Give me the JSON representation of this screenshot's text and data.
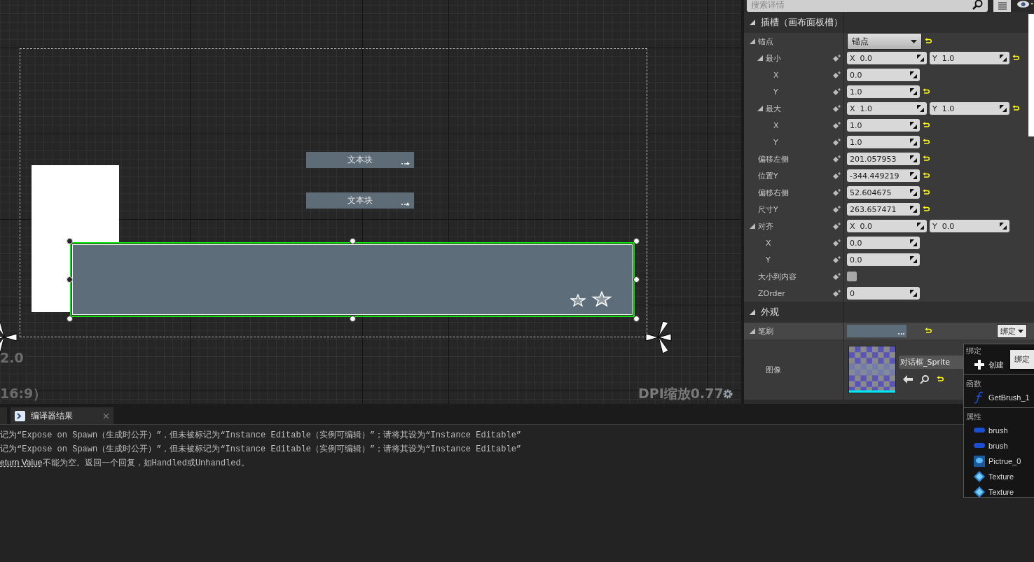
{
  "canvas": {
    "zoom_label": "2.0",
    "aspect_label": "16:9）",
    "dpi_label": "DPI缩放0.77",
    "text_blocks": [
      {
        "text": "文本块"
      },
      {
        "text": "文本块"
      }
    ],
    "image_widget": {
      "selected": true
    }
  },
  "details": {
    "search": {
      "placeholder": "搜索详情"
    },
    "sections": [
      {
        "title": "插槽（画布面板槽）",
        "expanded": true,
        "rows": [
          {
            "label": "锚点",
            "kind": "dropdown",
            "value": "锚点",
            "expanded": true,
            "bindable": false,
            "reset": true,
            "children": [
              {
                "label": "最小",
                "kind": "vector",
                "values": [
                  {
                    "axis": "X",
                    "value": "0.0"
                  },
                  {
                    "axis": "Y",
                    "value": "1.0"
                  }
                ],
                "expanded": true,
                "bindable": true,
                "reset": true,
                "children": [
                  {
                    "label": "X",
                    "kind": "number",
                    "value": "0.0",
                    "bindable": true,
                    "reset": false
                  },
                  {
                    "label": "Y",
                    "kind": "number",
                    "value": "1.0",
                    "bindable": true,
                    "reset": true
                  }
                ]
              },
              {
                "label": "最大",
                "kind": "vector",
                "values": [
                  {
                    "axis": "X",
                    "value": "1.0"
                  },
                  {
                    "axis": "Y",
                    "value": "1.0"
                  }
                ],
                "expanded": true,
                "bindable": true,
                "reset": true,
                "children": [
                  {
                    "label": "X",
                    "kind": "number",
                    "value": "1.0",
                    "bindable": true,
                    "reset": true
                  },
                  {
                    "label": "Y",
                    "kind": "number",
                    "value": "1.0",
                    "bindable": true,
                    "reset": true
                  }
                ]
              }
            ]
          },
          {
            "label": "偏移左侧",
            "kind": "number",
            "value": "201.057953",
            "bindable": true,
            "reset": true
          },
          {
            "label": "位置Y",
            "kind": "number",
            "value": "-344.449219",
            "bindable": true,
            "reset": true
          },
          {
            "label": "偏移右侧",
            "kind": "number",
            "value": "52.604675",
            "bindable": true,
            "reset": true
          },
          {
            "label": "尺寸Y",
            "kind": "number",
            "value": "263.657471",
            "bindable": true,
            "reset": true
          },
          {
            "label": "对齐",
            "kind": "vector",
            "values": [
              {
                "axis": "X",
                "value": "0.0"
              },
              {
                "axis": "Y",
                "value": "0.0"
              }
            ],
            "expanded": true,
            "bindable": true,
            "reset": false,
            "children": [
              {
                "label": "X",
                "kind": "number",
                "value": "0.0",
                "bindable": true,
                "reset": false
              },
              {
                "label": "Y",
                "kind": "number",
                "value": "0.0",
                "bindable": true,
                "reset": false
              }
            ]
          },
          {
            "label": "大小到内容",
            "kind": "checkbox",
            "checked": false,
            "bindable": true,
            "reset": false
          },
          {
            "label": "ZOrder",
            "kind": "number",
            "value": "0",
            "bindable": true,
            "reset": false
          }
        ]
      },
      {
        "title": "外观",
        "expanded": true,
        "rows": [
          {
            "label": "笔刷",
            "kind": "brush",
            "expanded": true,
            "bind_button": "绑定",
            "reset": true,
            "children": [
              {
                "label": "图像",
                "kind": "image",
                "asset": "对话框_Sprite",
                "reset": true
              }
            ]
          }
        ]
      }
    ]
  },
  "binding_menu": {
    "groups": [
      {
        "title": "绑定",
        "items": [
          {
            "kind": "create",
            "label": "创建"
          }
        ]
      },
      {
        "title": "函数",
        "items": [
          {
            "kind": "function",
            "label": "GetBrush_1"
          }
        ]
      },
      {
        "title": "属性",
        "items": [
          {
            "kind": "brush",
            "label": "brush"
          },
          {
            "kind": "brush",
            "label": "brush"
          },
          {
            "kind": "image",
            "label": "Pictrue_0"
          },
          {
            "kind": "texture",
            "label": "Texture"
          },
          {
            "kind": "texture",
            "label": "Texture"
          }
        ]
      }
    ],
    "tooltip": "绑定"
  },
  "output": {
    "tabs": [
      {
        "label": "编译器结果",
        "selected": true
      }
    ],
    "lines": [
      {
        "text": "记为“Expose on Spawn（生成时公开）”，但未被标记为“Instance Editable（实例可编辑）”；请将其设为“Instance Editable”"
      },
      {
        "text": "记为“Expose on Spawn（生成时公开）”，但未被标记为“Instance Editable（实例可编辑）”；请将其设为“Instance Editable”"
      },
      {
        "link": "eturn Value",
        "text": "不能为空。返回一个回复，如Handled或Unhandled。"
      }
    ]
  }
}
